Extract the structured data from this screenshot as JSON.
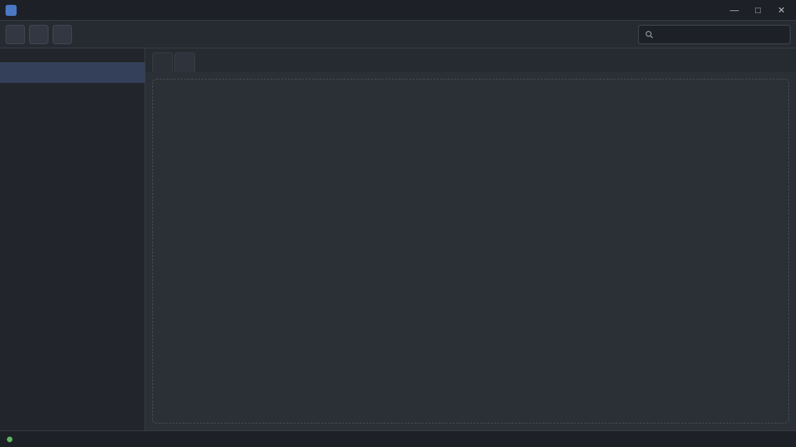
{
  "window": {
    "title": ""
  },
  "toolbar": {
    "buttons": [
      {
        "label": ""
      },
      {
        "label": ""
      },
      {
        "label": ""
      }
    ],
    "search": {
      "value": "",
      "placeholder": ""
    }
  },
  "sidebar": {
    "heading": "",
    "items": [
      {
        "label": ""
      },
      {
        "label": ""
      },
      {
        "label": ""
      },
      {
        "label": ""
      }
    ]
  },
  "main": {
    "tabs": [
      {
        "label": ""
      },
      {
        "label": ""
      }
    ],
    "message": ""
  },
  "status": {
    "left": "",
    "right": ""
  },
  "icons": {
    "app": "app-icon",
    "search": "search-icon",
    "minimize": "minimize-icon",
    "maximize": "maximize-icon",
    "close": "close-icon",
    "status": "status-dot-icon"
  },
  "colors": {
    "accent": "#4a78c2",
    "status_ok": "#5cb85c"
  }
}
